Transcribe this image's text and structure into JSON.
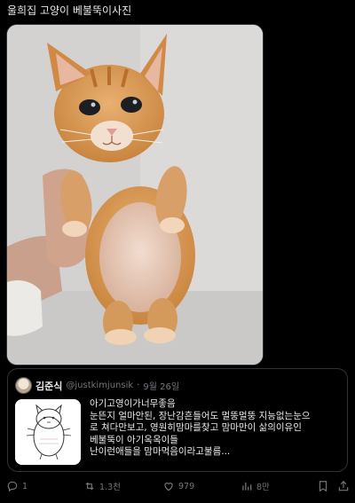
{
  "post": {
    "text": "울희집 고양이 베불뚝이사진"
  },
  "quote": {
    "author_name": "김준식",
    "handle": "@justkimjunsik",
    "separator": "·",
    "date": "9월 26일",
    "lines": [
      "아기고영이가너무좋음",
      "눈뜬지 얼마안된, 장난감흔들어도 멀뚱멀뚱 지능없는눈으",
      "로 쳐다만보고, 영원히맘마를찾고  맘마만이  삶의이유인",
      "베불뚝이  아기옥옥이들",
      "난이런애들을 맘마먹음이라고불름..."
    ]
  },
  "actions": {
    "replies": "1",
    "retweets": "1.3천",
    "likes": "979",
    "views": "8만"
  },
  "icons": [
    "reply-icon",
    "retweet-icon",
    "like-icon",
    "views-icon",
    "bookmark-icon",
    "share-icon"
  ]
}
